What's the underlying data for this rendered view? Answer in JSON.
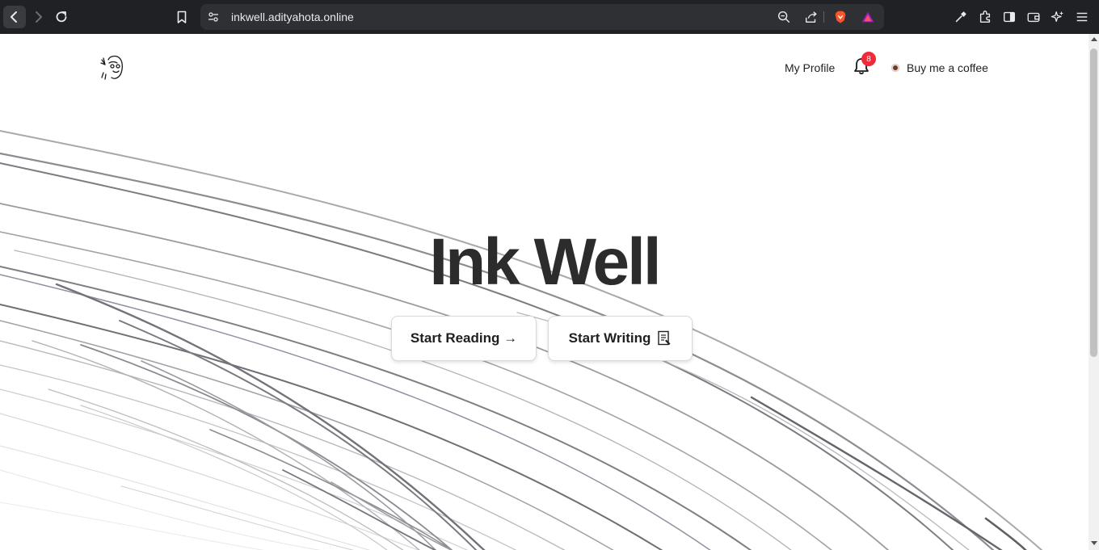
{
  "browser": {
    "url": "inkwell.adityahota.online",
    "icons": [
      "back-icon",
      "forward-icon",
      "reload-icon",
      "bookmark-icon",
      "site-settings-icon",
      "zoom-icon",
      "share-icon",
      "brave-shield-icon",
      "brave-rewards-icon",
      "eyedropper-icon",
      "extensions-icon",
      "sidebar-icon",
      "wallet-icon",
      "leo-ai-icon",
      "menu-icon"
    ]
  },
  "header": {
    "logo": "doodle-avatar-logo",
    "my_profile": "My Profile",
    "notification_count": "8",
    "buy_coffee": "Buy me a coffee"
  },
  "hero": {
    "title": "Ink Well",
    "start_reading": "Start Reading →",
    "start_writing": "Start Writing"
  },
  "colors": {
    "accent_badge": "#ef2b3a",
    "title": "#2c2c2c",
    "chrome_bg": "#202124"
  }
}
